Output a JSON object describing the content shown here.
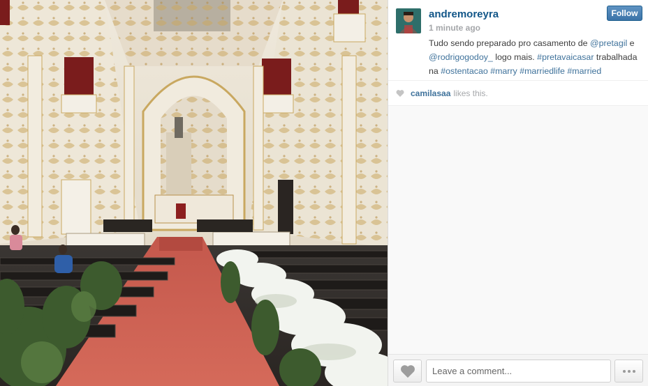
{
  "post": {
    "username": "andremoreyra",
    "timestamp": "1 minute ago",
    "follow_label": "Follow",
    "caption": {
      "text_1": "Tudo sendo preparado pro casamento de ",
      "mention_1": "@pretagil",
      "text_2": " e ",
      "mention_2": "@rodrigogodoy_",
      "text_3": " logo mais. ",
      "tag_1": "#pretavaicasar",
      "text_4": " trabalhada na ",
      "tag_2": "#ostentacao",
      "tag_3": "#marry",
      "tag_4": "#marriedlife",
      "tag_5": "#married"
    },
    "likes": {
      "liker": "camilasaa",
      "suffix": "likes this."
    }
  },
  "comment": {
    "placeholder": "Leave a comment..."
  },
  "icons": {
    "like": "heart-icon",
    "more": "ellipsis-icon",
    "likes_indicator": "heart-icon"
  },
  "colors": {
    "username": "#125688",
    "link": "#3f729b",
    "follow_button": "#3b73a8",
    "muted": "#a5a7aa"
  }
}
